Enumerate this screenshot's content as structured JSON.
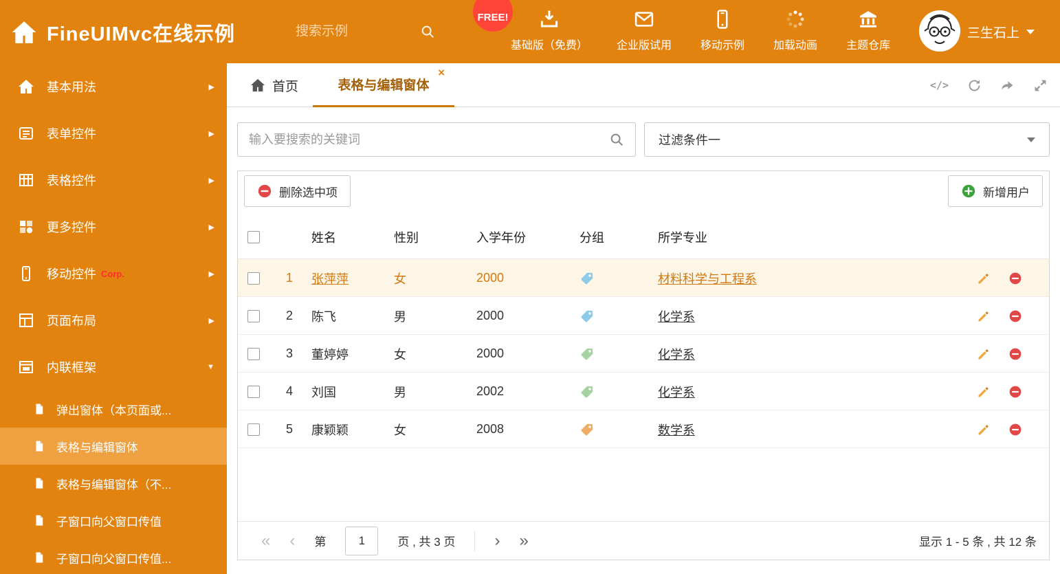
{
  "header": {
    "title": "FineUIMvc在线示例",
    "search_placeholder": "搜索示例",
    "free_badge": "FREE!",
    "nav_items": [
      {
        "label": "基础版（免费）",
        "icon": "download-icon"
      },
      {
        "label": "企业版试用",
        "icon": "envelope-icon"
      },
      {
        "label": "移动示例",
        "icon": "mobile-icon"
      },
      {
        "label": "加载动画",
        "icon": "spinner-icon"
      },
      {
        "label": "主题仓库",
        "icon": "bank-icon"
      }
    ],
    "user_name": "三生石上"
  },
  "sidebar": {
    "items": [
      {
        "label": "基本用法",
        "icon": "home-icon",
        "state": "collapsed"
      },
      {
        "label": "表单控件",
        "icon": "form-icon",
        "state": "collapsed"
      },
      {
        "label": "表格控件",
        "icon": "table-icon",
        "state": "collapsed"
      },
      {
        "label": "更多控件",
        "icon": "widgets-icon",
        "state": "collapsed"
      },
      {
        "label": "移动控件",
        "badge": "Corp.",
        "icon": "mobile-icon",
        "state": "collapsed"
      },
      {
        "label": "页面布局",
        "icon": "layout-icon",
        "state": "collapsed"
      },
      {
        "label": "内联框架",
        "icon": "frame-icon",
        "state": "expanded"
      }
    ],
    "subitems": [
      {
        "label": "弹出窗体（本页面或...",
        "active": false
      },
      {
        "label": "表格与编辑窗体",
        "active": true
      },
      {
        "label": "表格与编辑窗体（不...",
        "active": false
      },
      {
        "label": "子窗口向父窗口传值",
        "active": false
      },
      {
        "label": "子窗口向父窗口传值...",
        "active": false
      }
    ]
  },
  "tabbar": {
    "home_tab": "首页",
    "active_tab": "表格与编辑窗体"
  },
  "filterbar": {
    "search_placeholder": "输入要搜索的关键词",
    "filter_value": "过滤条件一"
  },
  "toolbar": {
    "delete_label": "删除选中项",
    "add_label": "新增用户"
  },
  "grid": {
    "columns": {
      "name": "姓名",
      "gender": "性别",
      "year": "入学年份",
      "group": "分组",
      "major": "所学专业"
    },
    "rows": [
      {
        "num": "1",
        "name": "张萍萍",
        "gender": "女",
        "year": "2000",
        "tag_color": "#8ecbe8",
        "major": "材料科学与工程系",
        "selected": true
      },
      {
        "num": "2",
        "name": "陈飞",
        "gender": "男",
        "year": "2000",
        "tag_color": "#8ecbe8",
        "major": "化学系",
        "selected": false
      },
      {
        "num": "3",
        "name": "董婷婷",
        "gender": "女",
        "year": "2000",
        "tag_color": "#a5d3a1",
        "major": "化学系",
        "selected": false
      },
      {
        "num": "4",
        "name": "刘国",
        "gender": "男",
        "year": "2002",
        "tag_color": "#a5d3a1",
        "major": "化学系",
        "selected": false
      },
      {
        "num": "5",
        "name": "康颖颖",
        "gender": "女",
        "year": "2008",
        "tag_color": "#f0ad66",
        "major": "数学系",
        "selected": false
      }
    ]
  },
  "pagination": {
    "page_prefix": "第",
    "page_value": "1",
    "page_suffix": "页 , 共 3 页",
    "summary": "显示 1 - 5 条 , 共 12 条"
  },
  "colors": {
    "header_bg": "#e2830f",
    "accent": "#c87a00",
    "sidebar_active_bg": "#efa041",
    "selected_row_bg": "#fdf6e6",
    "selected_row_text": "#d2780f",
    "free_badge_bg": "#ff4438"
  }
}
